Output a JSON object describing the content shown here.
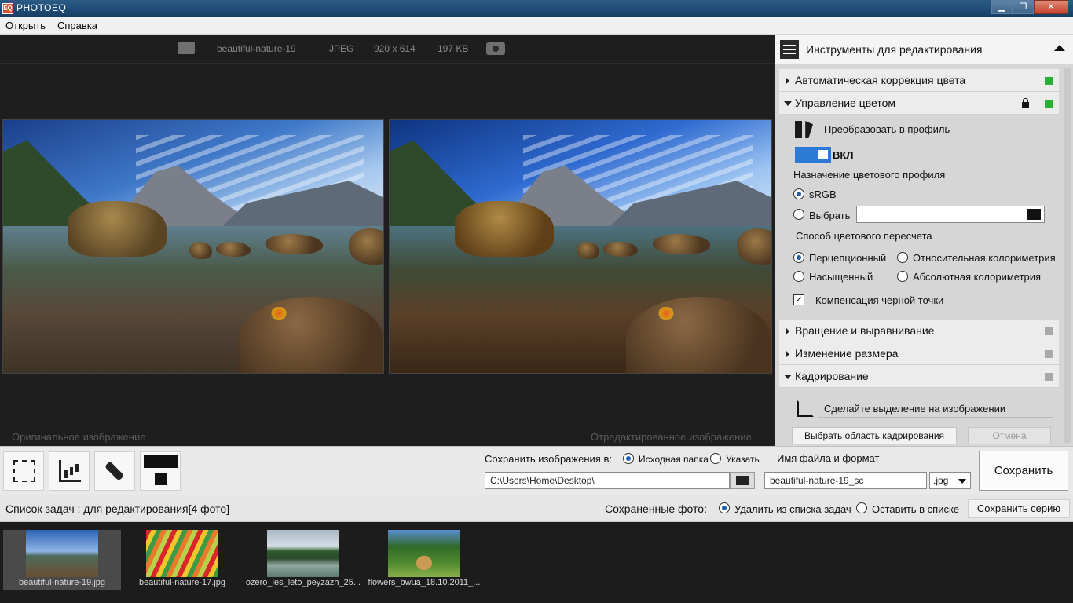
{
  "window": {
    "title": "PHOTOEQ",
    "app_icon_text": "EQ",
    "minimize": "▁",
    "maximize": "❐",
    "close": "✕"
  },
  "menu": {
    "items": [
      "Открыть",
      "Справка"
    ]
  },
  "viewer": {
    "info": {
      "filename": "beautiful-nature-19",
      "format": "JPEG",
      "dimensions": "920 x 614",
      "size": "197 KB"
    },
    "original_caption": "Оригинальное изображение",
    "edited_caption": "Отредактированное изображение"
  },
  "panel": {
    "title": "Инструменты для редактирования",
    "sections": {
      "auto_color": {
        "label": "Автоматическая коррекция цвета",
        "status": "on"
      },
      "color_management": {
        "label": "Управление цветом",
        "status": "on",
        "convert_label": "Преобразовать в профиль",
        "toggle_label": "ВКЛ",
        "profile_heading": "Назначение цветового профиля",
        "profile_options": [
          "sRGB",
          "Выбрать"
        ],
        "profile_selected": "sRGB",
        "intent_heading": "Способ цветового пересчета",
        "intents": [
          "Перцепционный",
          "Относительная колориметрия",
          "Насыщенный",
          "Абсолютная колориметрия"
        ],
        "intent_selected": "Перцепционный",
        "black_point": "Компенсация черной точки",
        "black_point_checked": true
      },
      "rotate": {
        "label": "Вращение и выравнивание",
        "status": "off"
      },
      "resize": {
        "label": "Изменение размера",
        "status": "off"
      },
      "crop": {
        "label": "Кадрирование",
        "status": "off",
        "hint": "Сделайте выделение на изображении",
        "select_button": "Выбрать область кадрирования",
        "cancel_button": "Отмена"
      }
    }
  },
  "save": {
    "save_to_label": "Сохранить изображения в:",
    "source_folder": "Исходная папка",
    "specify": "Указать",
    "path": "C:\\Users\\Home\\Desktop\\",
    "filename_label": "Имя файла и формат",
    "filename": "beautiful-nature-19_sc",
    "format": ".jpg",
    "save_button": "Сохранить"
  },
  "tasks": {
    "label": "Список задач : для редактирования[4 фото]",
    "saved_label": "Сохраненные фото:",
    "remove_option": "Удалить из списка задач",
    "keep_option": "Оставить в списке",
    "series_button": "Сохранить серию",
    "thumbnails": [
      {
        "name": "beautiful-nature-19.jpg"
      },
      {
        "name": "beautiful-nature-17.jpg"
      },
      {
        "name": "ozero_les_leto_peyzazh_25..."
      },
      {
        "name": "flowers_bwua_18.10.2011_..."
      }
    ]
  },
  "colors": {
    "accent": "#2d79d6",
    "status_on": "#28b034",
    "status_off": "#a9a9a9",
    "titlebar": "#1d4a74"
  }
}
